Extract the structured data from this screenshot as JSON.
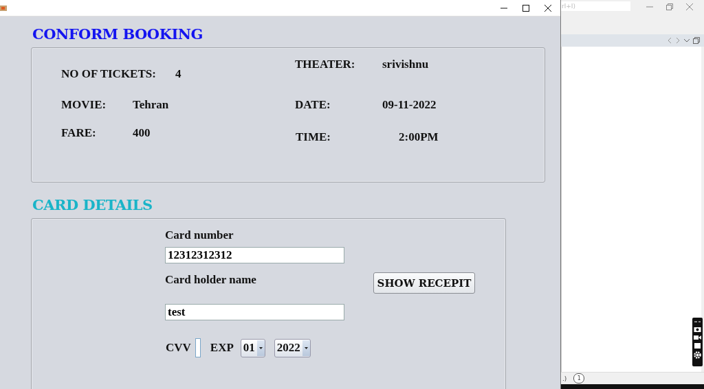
{
  "booking": {
    "title": "CONFORM BOOKING",
    "left": [
      {
        "label": "NO OF TICKETS:",
        "value": "4"
      },
      {
        "label": "MOVIE:",
        "value": "Tehran"
      },
      {
        "label": "FARE:",
        "value": "400"
      }
    ],
    "right": [
      {
        "label": "THEATER:",
        "value": "srivishnu"
      },
      {
        "label": "DATE:",
        "value": "09-11-2022"
      },
      {
        "label": "TIME:",
        "value": "2:00PM"
      }
    ]
  },
  "card": {
    "title": "CARD DETAILS",
    "card_number": {
      "label": "Card number",
      "value": "12312312312"
    },
    "holder_name": {
      "label": "Card holder name",
      "value": "test"
    },
    "cvv": {
      "label": "CVV"
    },
    "exp": {
      "label": "EXP",
      "month": "01",
      "year": "2022"
    },
    "button": "SHOW RECEPIT"
  },
  "background_window": {
    "search_hint": "rl+I)",
    "status_text": ".)",
    "notification_count": "1"
  }
}
